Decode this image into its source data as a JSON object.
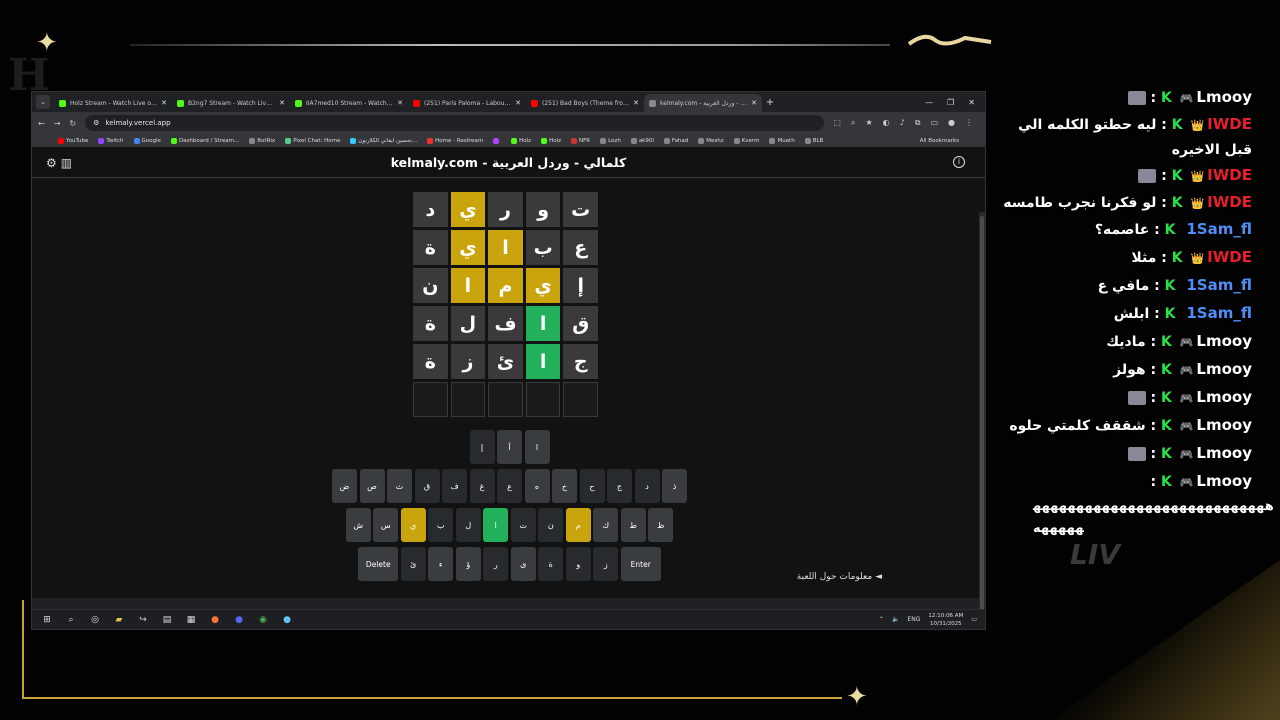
{
  "browser": {
    "tabs": [
      {
        "title": "Holz Stream - Watch Live on Kick",
        "color": "#53fc18",
        "active": false
      },
      {
        "title": "B2ng7 Stream - Watch Live on Kick",
        "color": "#53fc18",
        "active": false
      },
      {
        "title": "IIA7med10 Stream - Watch Live on Kick",
        "color": "#53fc18",
        "active": false
      },
      {
        "title": "(251) Paris Paloma - Labour - YouTube",
        "color": "#ff0000",
        "active": false
      },
      {
        "title": "(251) Bad Boys (Theme from Cops)",
        "color": "#ff0000",
        "active": false
      },
      {
        "title": "kelmaly.com - كلمالي - وردل العربية",
        "color": "#888888",
        "active": true
      }
    ],
    "url": "kelmaly.vercel.app",
    "bookmarks": [
      "YouTube",
      "Twitch",
      "Google",
      "Dashboard / Stream...",
      "BotRix",
      "Pixel Chat: Home",
      "تحسين ايقاني الكلارنون...",
      "Home - Restream",
      "",
      "Holz",
      "Holz",
      "NFR",
      "Lozh",
      "ak90l",
      "Fahad",
      "Meshz",
      "Kverm",
      "Muath",
      "BLB"
    ],
    "all_bookmarks": "All Bookmarks"
  },
  "page": {
    "title": "kelmaly.com - كلمالي - وردل العربية",
    "about": "معلومات حول اللعبة ◄",
    "grid": [
      [
        {
          "l": "ت",
          "s": "a"
        },
        {
          "l": "و",
          "s": "a"
        },
        {
          "l": "ر",
          "s": "a"
        },
        {
          "l": "ي",
          "s": "p"
        },
        {
          "l": "د",
          "s": "a"
        }
      ],
      [
        {
          "l": "ع",
          "s": "a"
        },
        {
          "l": "ب",
          "s": "a"
        },
        {
          "l": "ا",
          "s": "p"
        },
        {
          "l": "ي",
          "s": "p"
        },
        {
          "l": "ة",
          "s": "a"
        }
      ],
      [
        {
          "l": "إ",
          "s": "a"
        },
        {
          "l": "ي",
          "s": "p"
        },
        {
          "l": "م",
          "s": "p"
        },
        {
          "l": "ا",
          "s": "p"
        },
        {
          "l": "ن",
          "s": "a"
        }
      ],
      [
        {
          "l": "ق",
          "s": "a"
        },
        {
          "l": "ا",
          "s": "c"
        },
        {
          "l": "ف",
          "s": "a"
        },
        {
          "l": "ل",
          "s": "a"
        },
        {
          "l": "ة",
          "s": "a"
        }
      ],
      [
        {
          "l": "ج",
          "s": "a"
        },
        {
          "l": "ا",
          "s": "c"
        },
        {
          "l": "ئ",
          "s": "a"
        },
        {
          "l": "ز",
          "s": "a"
        },
        {
          "l": "ة",
          "s": "a"
        }
      ],
      [
        {
          "l": "",
          "s": "e"
        },
        {
          "l": "",
          "s": "e"
        },
        {
          "l": "",
          "s": "e"
        },
        {
          "l": "",
          "s": "e"
        },
        {
          "l": "",
          "s": "e"
        }
      ]
    ],
    "keyboard": [
      [
        {
          "k": "ا",
          "s": "a"
        },
        {
          "k": "آ",
          "s": "a"
        },
        {
          "k": "إ",
          "s": "d"
        }
      ],
      [
        {
          "k": "ذ",
          "s": "a"
        },
        {
          "k": "د",
          "s": "d"
        },
        {
          "k": "ج",
          "s": "d"
        },
        {
          "k": "ح",
          "s": "d"
        },
        {
          "k": "خ",
          "s": "a"
        },
        {
          "k": "ه",
          "s": "a"
        },
        {
          "k": "ع",
          "s": "d"
        },
        {
          "k": "غ",
          "s": "d"
        },
        {
          "k": "ف",
          "s": "d"
        },
        {
          "k": "ق",
          "s": "d"
        },
        {
          "k": "ث",
          "s": "a"
        },
        {
          "k": "ص",
          "s": "a"
        },
        {
          "k": "ض",
          "s": "a"
        }
      ],
      [
        {
          "k": "ظ",
          "s": "a"
        },
        {
          "k": "ط",
          "s": "a"
        },
        {
          "k": "ك",
          "s": "a"
        },
        {
          "k": "م",
          "s": "p"
        },
        {
          "k": "ن",
          "s": "d"
        },
        {
          "k": "ت",
          "s": "d"
        },
        {
          "k": "ا",
          "s": "c"
        },
        {
          "k": "ل",
          "s": "d"
        },
        {
          "k": "ب",
          "s": "d"
        },
        {
          "k": "ي",
          "s": "p"
        },
        {
          "k": "س",
          "s": "a"
        },
        {
          "k": "ش",
          "s": "a"
        }
      ],
      [
        {
          "k": "Enter",
          "s": "w"
        },
        {
          "k": "ز",
          "s": "d"
        },
        {
          "k": "و",
          "s": "d"
        },
        {
          "k": "ة",
          "s": "d"
        },
        {
          "k": "ى",
          "s": "a"
        },
        {
          "k": "ر",
          "s": "d"
        },
        {
          "k": "ؤ",
          "s": "a"
        },
        {
          "k": "ء",
          "s": "a"
        },
        {
          "k": "ئ",
          "s": "d"
        },
        {
          "k": "Delete",
          "s": "w"
        }
      ]
    ]
  },
  "taskbar": {
    "lang": "ENG",
    "time": "12:10:06 AM",
    "date": "10/31/2025"
  },
  "chat": {
    "messages": [
      {
        "user": "Lmooy",
        "badge": "🎮",
        "color": "#ffffff",
        "text": "",
        "emote": true
      },
      {
        "user": "IWDE",
        "badge": "👑",
        "color": "#e8202e",
        "text": "ليه حطتو الكلمه الي قبل الاخيره",
        "emote": false
      },
      {
        "user": "IWDE",
        "badge": "👑",
        "color": "#e8202e",
        "text": "",
        "emote": true
      },
      {
        "user": "IWDE",
        "badge": "👑",
        "color": "#e8202e",
        "text": "لو فكرنا نجرب طامسه",
        "emote": false
      },
      {
        "user": "1Sam_fl",
        "badge": "",
        "color": "#4f8ef7",
        "text": "عاصمه؟",
        "emote": false
      },
      {
        "user": "IWDE",
        "badge": "👑",
        "color": "#e8202e",
        "text": "مثلا",
        "emote": false
      },
      {
        "user": "1Sam_fl",
        "badge": "",
        "color": "#4f8ef7",
        "text": "مافي ع",
        "emote": false
      },
      {
        "user": "1Sam_fl",
        "badge": "",
        "color": "#4f8ef7",
        "text": "ابلش",
        "emote": false
      },
      {
        "user": "Lmooy",
        "badge": "🎮",
        "color": "#ffffff",
        "text": "ماديك",
        "emote": false
      },
      {
        "user": "Lmooy",
        "badge": "🎮",
        "color": "#ffffff",
        "text": "هولز",
        "emote": false
      },
      {
        "user": "Lmooy",
        "badge": "🎮",
        "color": "#ffffff",
        "text": "",
        "emote": true
      },
      {
        "user": "Lmooy",
        "badge": "🎮",
        "color": "#ffffff",
        "text": "شققف كلمتي حلوه",
        "emote": false
      },
      {
        "user": "Lmooy",
        "badge": "🎮",
        "color": "#ffffff",
        "text": "",
        "emote": true
      },
      {
        "user": "Lmooy",
        "badge": "🎮",
        "color": "#ffffff",
        "text": "",
        "emote": false
      }
    ],
    "long_text": "هههههههههههههههههههههههههههههههههه"
  }
}
